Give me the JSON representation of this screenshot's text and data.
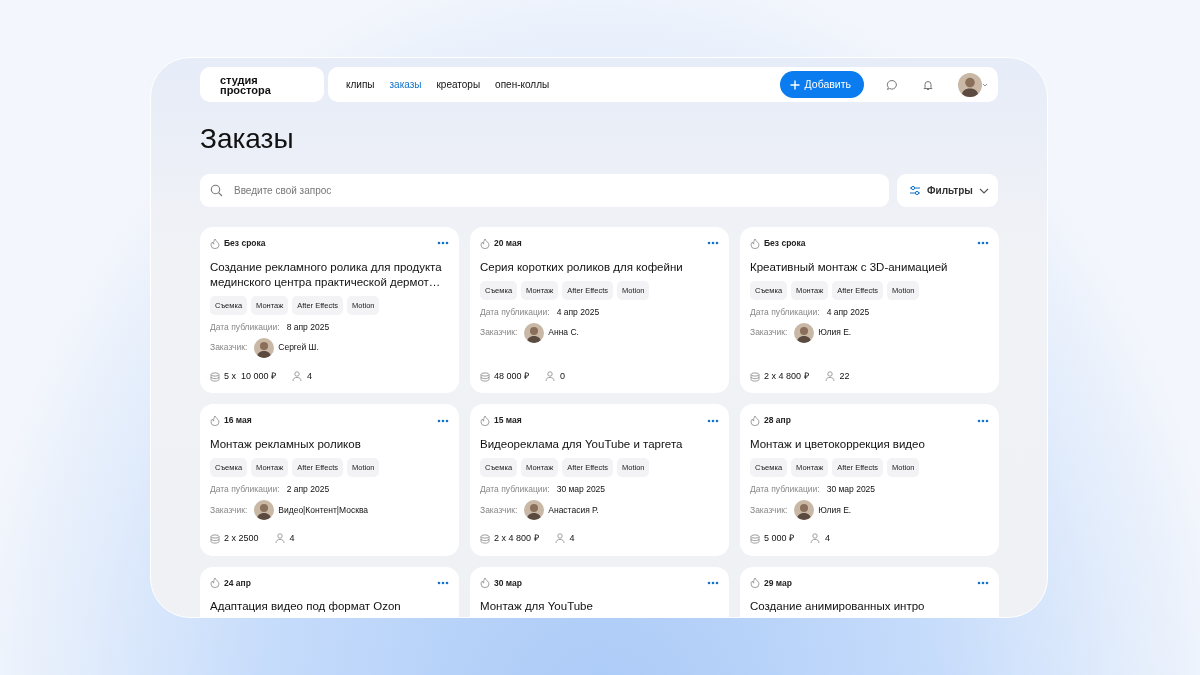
{
  "header": {
    "logo_lines": [
      "студия",
      "простора"
    ],
    "nav": [
      {
        "label": "клипы",
        "selected": false
      },
      {
        "label": "заказы",
        "selected": true
      },
      {
        "label": "креаторы",
        "selected": false
      },
      {
        "label": "опен-коллы",
        "selected": false
      }
    ],
    "add_button": "Добавить"
  },
  "title": "Заказы",
  "search": {
    "placeholder": "Введите свой запрос"
  },
  "filters_button": "Фильтры",
  "orders": [
    {
      "deadline": "Без срока",
      "title": "Создание рекламного ролика для продукта мединского центра практической дермот…",
      "tags": [
        "Съемка",
        "Монтаж",
        "After Effects",
        "Motion"
      ],
      "pub_label": "Дата публикации:",
      "pub_date": "8 апр 2025",
      "customer_label": "Заказчик:",
      "customer": "Сергей Ш.",
      "price": "5 x  10 000 ₽",
      "responses": "4"
    },
    {
      "deadline": "20 мая",
      "title": "Серия коротких роликов для кофейни",
      "tags": [
        "Съемка",
        "Монтаж",
        "After Effects",
        "Motion"
      ],
      "pub_label": "Дата публикации:",
      "pub_date": "4 апр 2025",
      "customer_label": "Заказчик:",
      "customer": "Анна С.",
      "price": "48 000 ₽",
      "responses": "0"
    },
    {
      "deadline": "Без срока",
      "title": "Креативный монтаж с 3D-анимацией",
      "tags": [
        "Съемка",
        "Монтаж",
        "After Effects",
        "Motion"
      ],
      "pub_label": "Дата публикации:",
      "pub_date": "4 апр 2025",
      "customer_label": "Заказчик:",
      "customer": "Юлия Е.",
      "price": "2 x 4 800 ₽",
      "responses": "22"
    },
    {
      "deadline": "16 мая",
      "title": "Монтаж рекламных роликов",
      "tags": [
        "Съемка",
        "Монтаж",
        "After Effects",
        "Motion"
      ],
      "pub_label": "Дата публикации:",
      "pub_date": "2 апр 2025",
      "customer_label": "Заказчик:",
      "customer": "Видео|Контент|Москва",
      "price": "2 x 2500",
      "responses": "4"
    },
    {
      "deadline": "15 мая",
      "title": "Видеореклама для YouTube и таргета",
      "tags": [
        "Съемка",
        "Монтаж",
        "After Effects",
        "Motion"
      ],
      "pub_label": "Дата публикации:",
      "pub_date": "30 мар 2025",
      "customer_label": "Заказчик:",
      "customer": "Анастасия Р.",
      "price": "2 x 4 800 ₽",
      "responses": "4"
    },
    {
      "deadline": "28 апр",
      "title": "Монтаж и цветокоррекция видео",
      "tags": [
        "Съемка",
        "Монтаж",
        "After Effects",
        "Motion"
      ],
      "pub_label": "Дата публикации:",
      "pub_date": "30 мар 2025",
      "customer_label": "Заказчик:",
      "customer": "Юлия Е.",
      "price": "5 000 ₽",
      "responses": "4"
    },
    {
      "deadline": "24 апр",
      "title": "Адаптация видео под формат Ozon"
    },
    {
      "deadline": "30 мар",
      "title": "Монтаж для YouTube"
    },
    {
      "deadline": "29 мар",
      "title": "Создание анимированных интро"
    }
  ]
}
